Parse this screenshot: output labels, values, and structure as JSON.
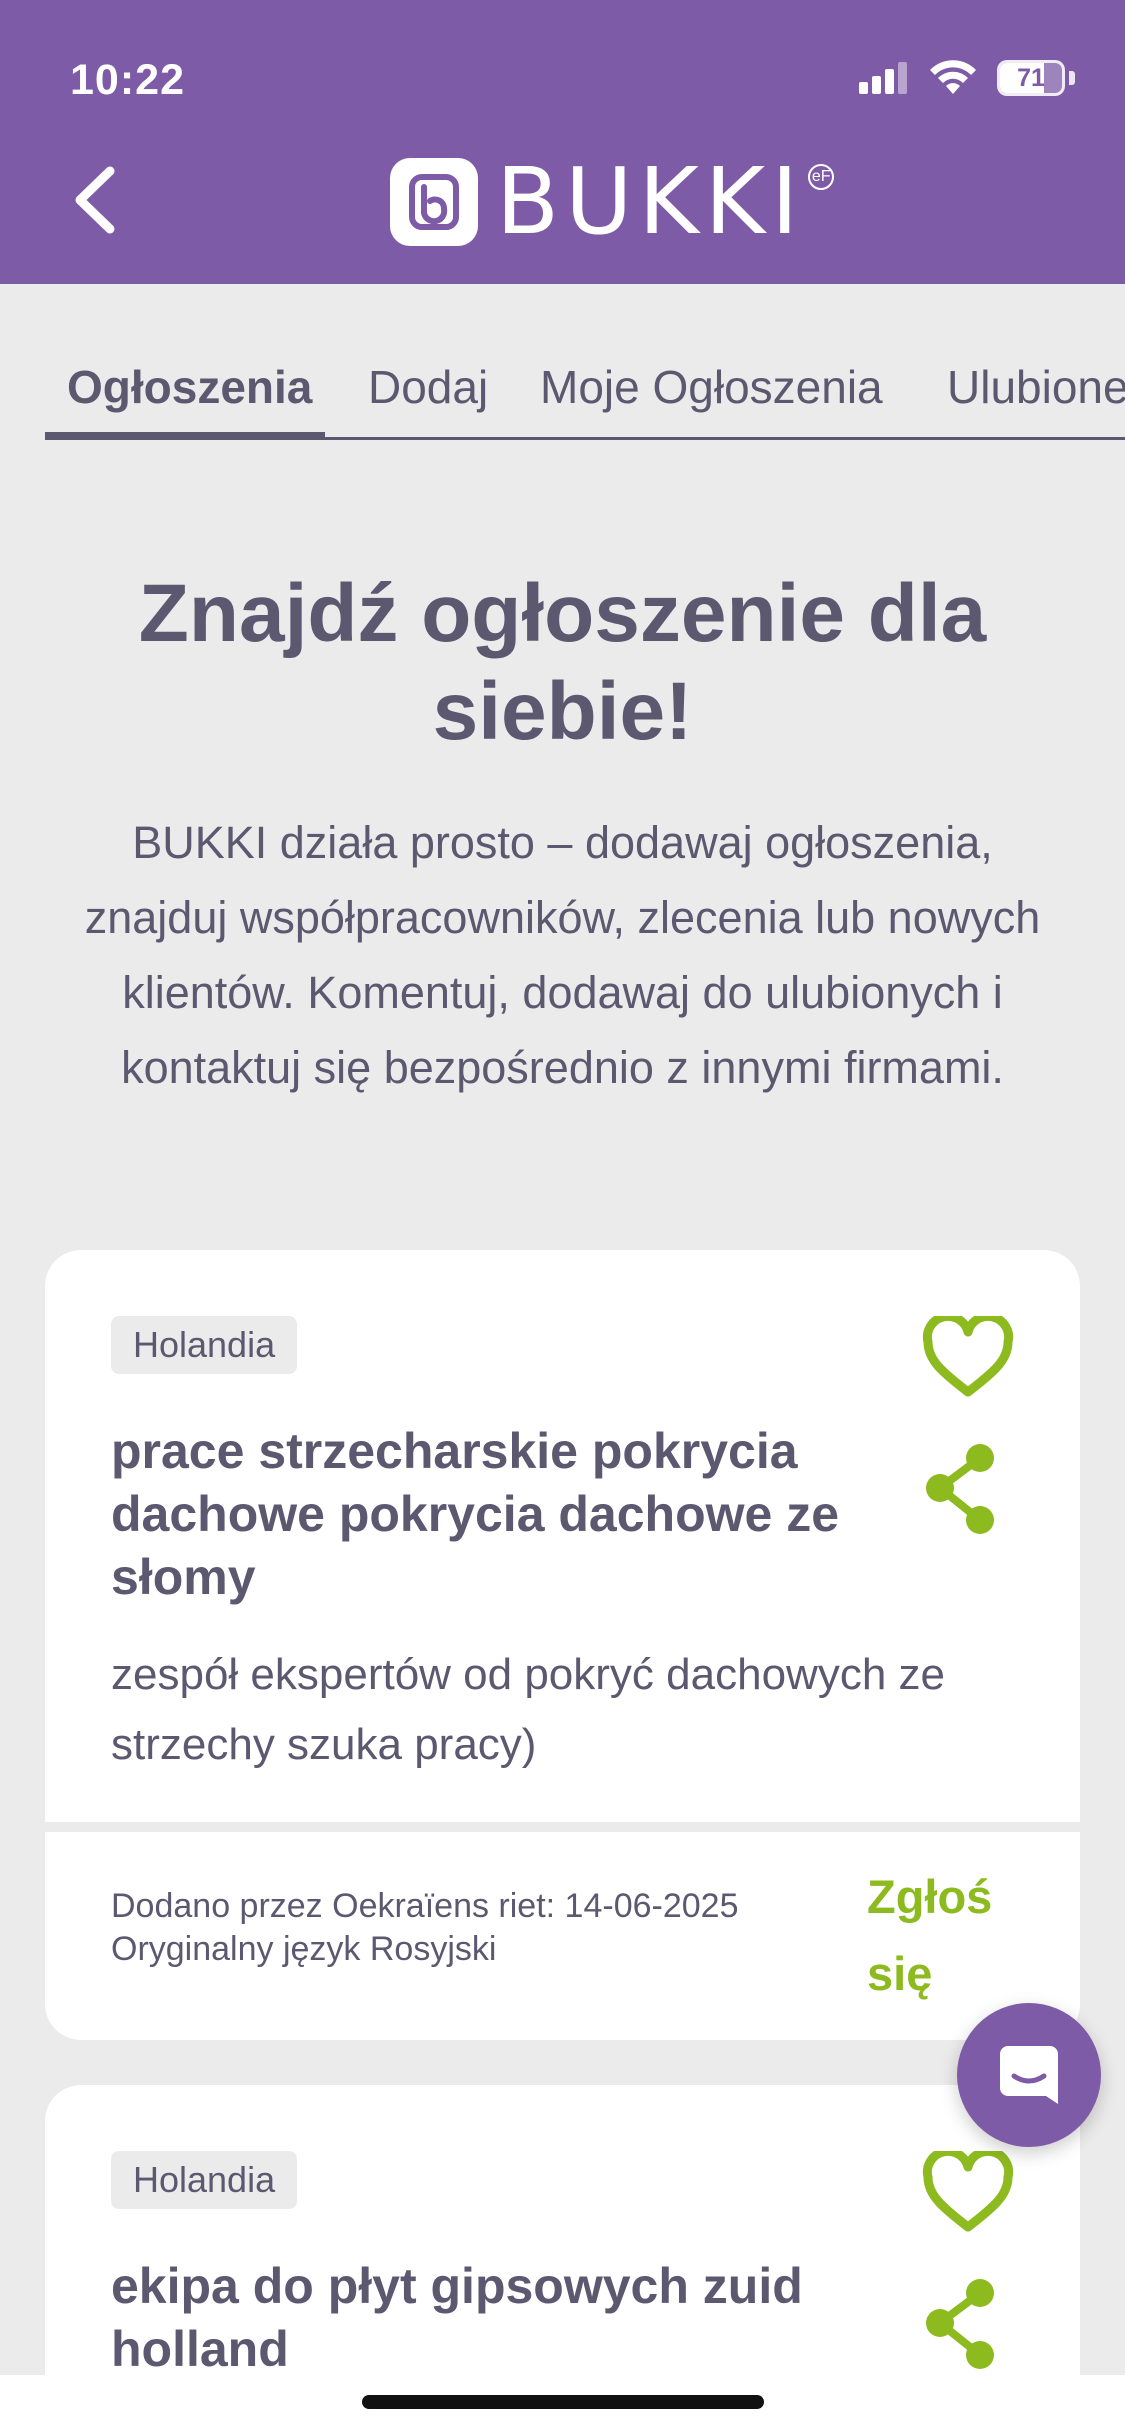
{
  "status_bar": {
    "time": "10:22",
    "battery": "71",
    "battery_level": 0.71
  },
  "header": {
    "logo_text": "BUKKI",
    "logo_badge": "eF"
  },
  "tabs": [
    {
      "label": "Ogłoszenia",
      "active": true
    },
    {
      "label": "Dodaj",
      "active": false
    },
    {
      "label": "Moje Ogłoszenia",
      "active": false
    },
    {
      "label": "Ulubione",
      "active": false
    }
  ],
  "hero": {
    "title": "Znajdź ogłoszenie dla siebie!",
    "description": "BUKKI działa prosto – dodawaj ogłoszenia, znajduj współpracowników, zlecenia lub nowych klientów. Komentuj, dodawaj do ulubionych i kontaktuj się bezpośrednio z innymi firmami."
  },
  "listings": [
    {
      "country": "Holandia",
      "title": "prace strzecharskie pokrycia dachowe pokrycia dachowe ze słomy",
      "description": "zespół ekspertów od pokryć dachowych ze strzechy szuka pracy)",
      "added_by": "Dodano przez Oekraïens riet: 14-06-2025",
      "language": "Oryginalny język Rosyjski",
      "apply_label": "Zgłoś się"
    },
    {
      "country": "Holandia",
      "title": "ekipa do płyt gipsowych zuid holland"
    }
  ],
  "colors": {
    "brand_purple": "#7E5BA6",
    "accent_green": "#8DBA1F",
    "text": "#5B5870",
    "background": "#EBEBEB"
  },
  "icons": {
    "back": "chevron-left-icon",
    "favorite": "heart-outline-icon",
    "share": "share-icon",
    "chat": "chat-bubble-icon"
  }
}
